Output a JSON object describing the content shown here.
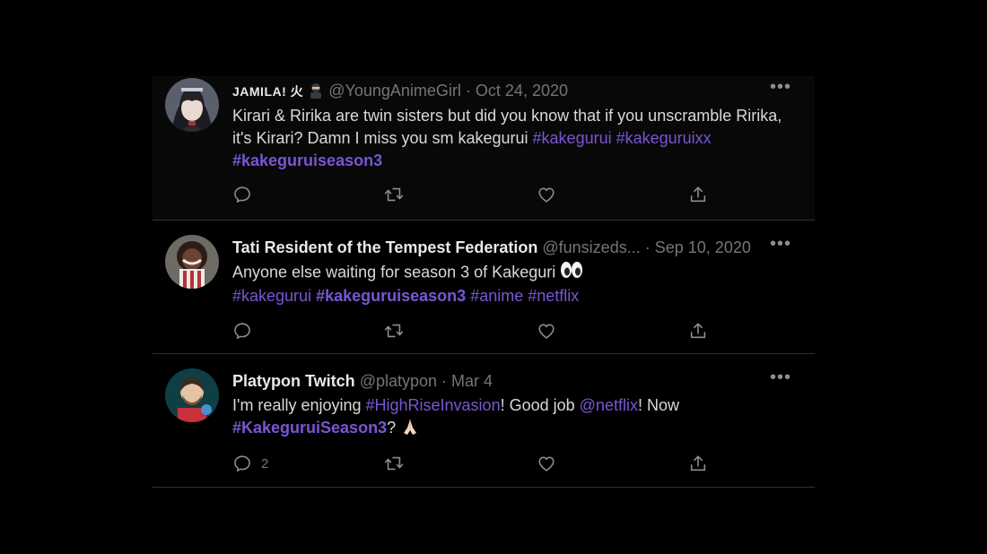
{
  "tweets": [
    {
      "name": "JAMILA! 火",
      "handle": "@YoungAnimeGirl",
      "sep": "·",
      "date": "Oct 24, 2020",
      "more": "•••",
      "text_parts": [
        "Kirari & Ririka are twin sisters but did you know that if you unscramble Ririka, it's Kirari? Damn I miss you sm kakegurui "
      ],
      "tags": [
        "#kakegurui",
        "#kakeguruixx",
        "#kakeguruiseason3"
      ],
      "reply_count": "",
      "icons": [
        "reply-icon",
        "retweet-icon",
        "like-icon",
        "share-icon"
      ]
    },
    {
      "name": "Tati Resident of the Tempest Federation",
      "handle": "@funsizeds...",
      "sep": "·",
      "date": "Sep 10, 2020",
      "more": "•••",
      "text_parts": [
        "Anyone else waiting for season 3 of Kakeguri "
      ],
      "tags": [
        "#kakegurui",
        "#kakeguruiseason3",
        "#anime",
        "#netflix"
      ],
      "reply_count": "",
      "icons": [
        "reply-icon",
        "retweet-icon",
        "like-icon",
        "share-icon"
      ]
    },
    {
      "name": "Platypon Twitch",
      "handle": "@platypon",
      "sep": "·",
      "date": "Mar 4",
      "more": "•••",
      "text_parts": [
        "I'm really enjoying ",
        "! Good job ",
        "! Now ",
        "? "
      ],
      "tags": [
        "#HighRiseInvasion",
        "@netflix",
        "#KakeguruiSeason3"
      ],
      "reply_count": "2",
      "icons": [
        "reply-icon",
        "retweet-icon",
        "like-icon",
        "share-icon"
      ]
    }
  ],
  "colors": {
    "background": "#000000",
    "text": "#d9d9d9",
    "muted": "#71767b",
    "hashtag": "#7856d4",
    "divider": "#2f3336"
  }
}
